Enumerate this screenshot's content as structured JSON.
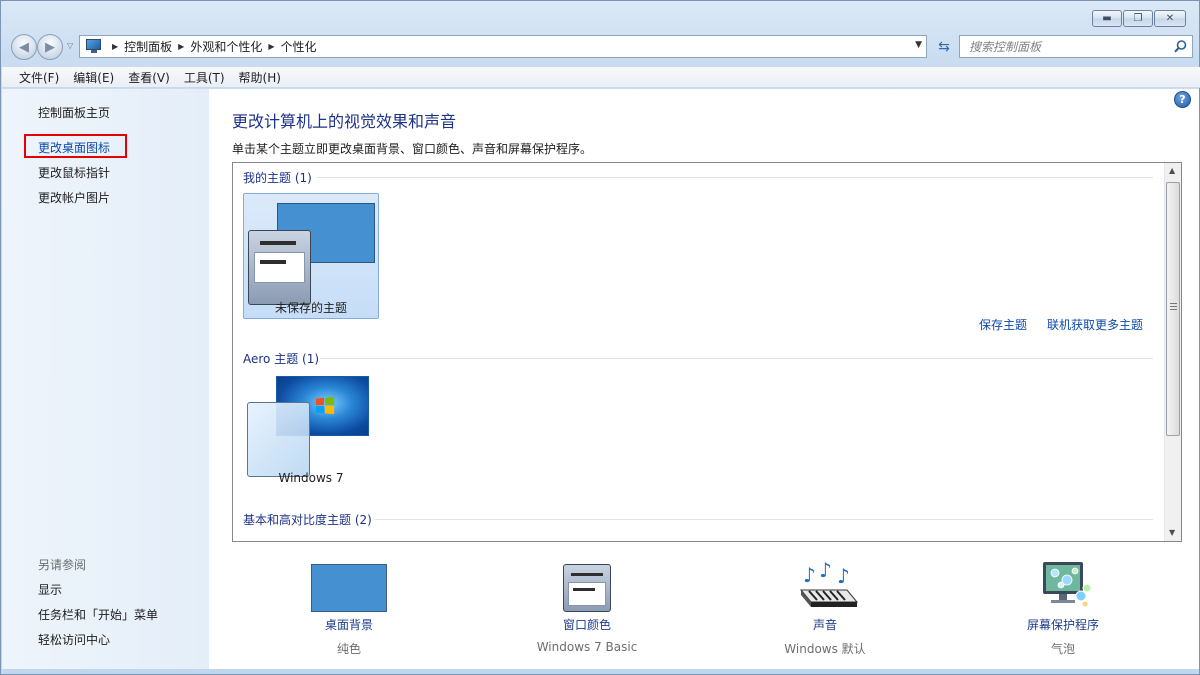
{
  "address": {
    "crumbs": [
      "控制面板",
      "外观和个性化",
      "个性化"
    ],
    "search_placeholder": "搜索控制面板"
  },
  "menu": [
    "文件(F)",
    "编辑(E)",
    "查看(V)",
    "工具(T)",
    "帮助(H)"
  ],
  "left_pane": {
    "home": "控制面板主页",
    "links": [
      "更改桌面图标",
      "更改鼠标指针",
      "更改帐户图片"
    ],
    "see_also_title": "另请参阅",
    "see_also": [
      "显示",
      "任务栏和「开始」菜单",
      "轻松访问中心"
    ]
  },
  "main": {
    "title": "更改计算机上的视觉效果和声音",
    "subtitle": "单击某个主题立即更改桌面背景、窗口颜色、声音和屏幕保护程序。",
    "groups": {
      "my": "我的主题 (1)",
      "aero": "Aero 主题 (1)",
      "basic": "基本和高对比度主题 (2)"
    },
    "themes": {
      "unsaved": "未保存的主题",
      "win7": "Windows 7"
    },
    "links": {
      "save": "保存主题",
      "more": "联机获取更多主题"
    }
  },
  "settings": [
    {
      "label": "桌面背景",
      "value": "纯色"
    },
    {
      "label": "窗口颜色",
      "value": "Windows 7 Basic"
    },
    {
      "label": "声音",
      "value": "Windows 默认"
    },
    {
      "label": "屏幕保护程序",
      "value": "气泡"
    }
  ],
  "colors": {
    "title_blue": "#1e3287",
    "link_blue": "#0e4aa8",
    "highlight_red": "#e60000",
    "preview_blue": "#4590d0"
  }
}
